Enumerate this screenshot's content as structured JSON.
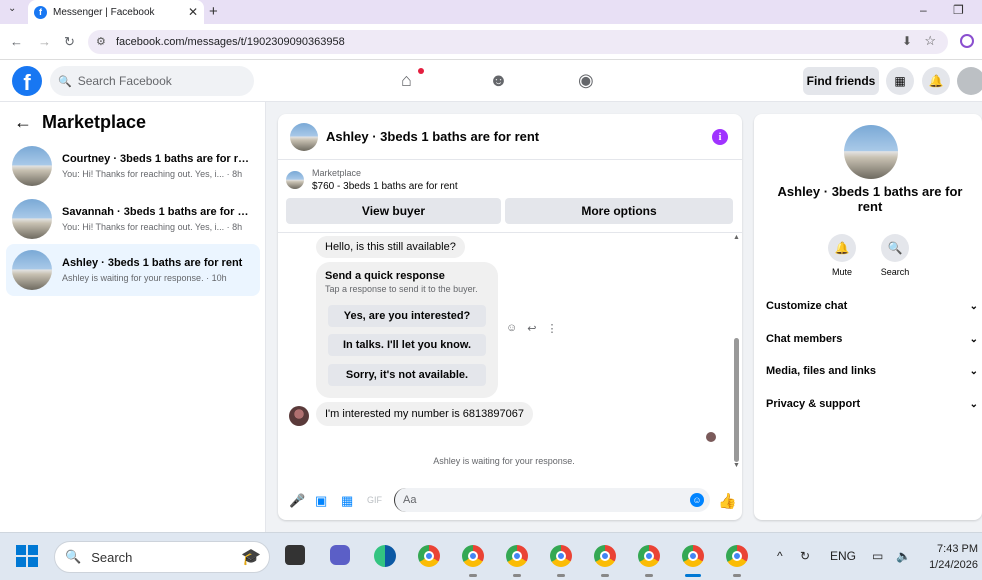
{
  "browser": {
    "tab_title": "Messenger | Facebook",
    "url": "facebook.com/messages/t/1902309090363958"
  },
  "fb": {
    "search_placeholder": "Search Facebook",
    "find_friends": "Find friends"
  },
  "left": {
    "title": "Marketplace",
    "conversations": [
      {
        "title": "Courtney · 3beds 1 baths are for rent",
        "preview": "You: Hi! Thanks for reaching out. Yes, i... · 8h"
      },
      {
        "title": "Savannah · 3beds 1 baths are for r...",
        "preview": "You: Hi! Thanks for reaching out. Yes, i... · 8h"
      },
      {
        "title": "Ashley · 3beds 1 baths are for rent",
        "preview": "Ashley is waiting for your response. · 10h"
      }
    ]
  },
  "chat": {
    "title": "Ashley · 3beds 1 baths are for rent",
    "marketplace_label": "Marketplace",
    "listing": "$760 - 3beds 1 baths are for rent",
    "view_buyer": "View buyer",
    "more_options": "More options",
    "msg_available": "Hello, is this still available?",
    "quick_title": "Send a quick response",
    "quick_sub": "Tap a response to send it to the buyer.",
    "quick_options": [
      "Yes, are you interested?",
      "In talks. I'll let you know.",
      "Sorry, it's not available."
    ],
    "msg_interested": "I'm interested my number is 6813897067",
    "waiting": "Ashley is waiting for your response.",
    "compose_placeholder": "Aa"
  },
  "right": {
    "name": "Ashley · 3beds 1 baths are for rent",
    "mute": "Mute",
    "search": "Search",
    "sections": [
      "Customize chat",
      "Chat members",
      "Media, files and links",
      "Privacy & support"
    ]
  },
  "taskbar": {
    "search": "Search",
    "lang": "ENG",
    "time": "7:43 PM",
    "date": "1/24/2026"
  },
  "colors": {
    "fb_blue": "#1877f2",
    "messenger_blue": "#0084ff",
    "info_purple": "#a033ff",
    "notify_red": "#e41e3f"
  }
}
